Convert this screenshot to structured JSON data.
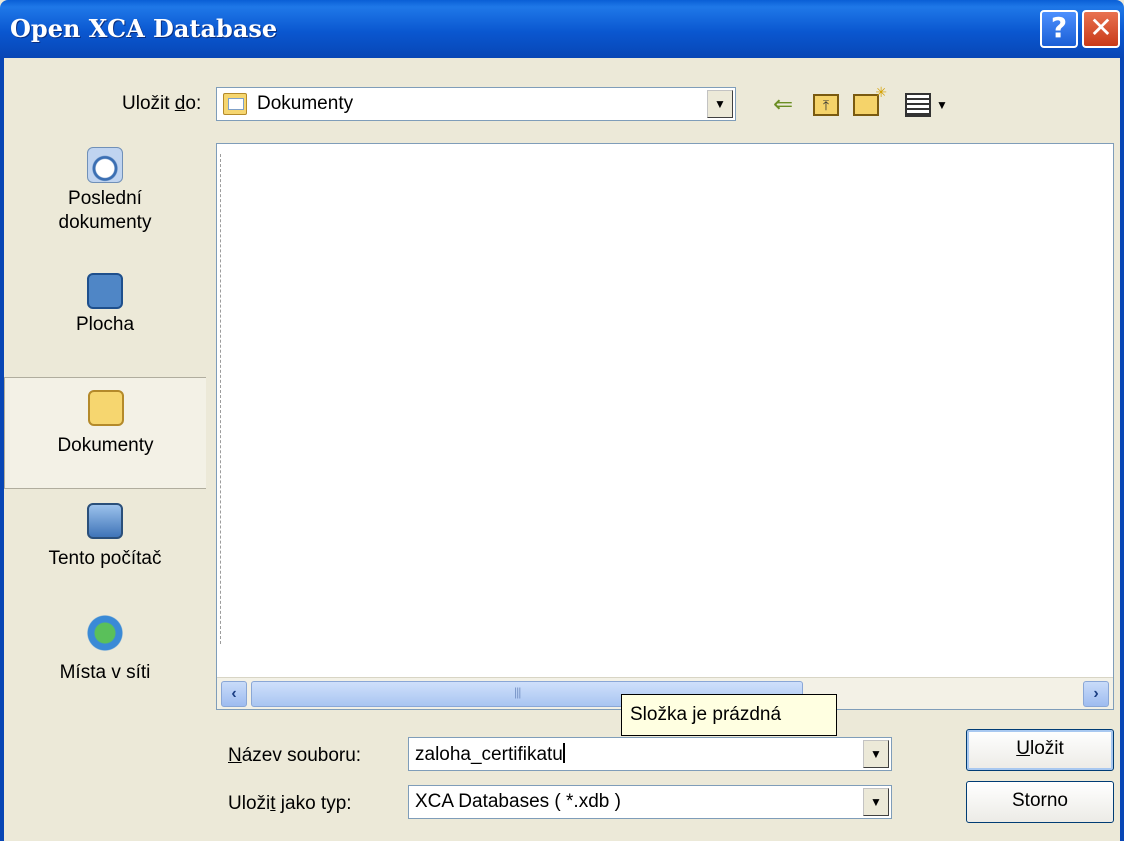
{
  "window": {
    "title": "Open XCA Database",
    "help_glyph": "?",
    "close_glyph": "✕"
  },
  "toolbar": {
    "lookin_label_pre": "Uložit ",
    "lookin_label_accel": "d",
    "lookin_label_post": "o:",
    "lookin_value": "Dokumenty",
    "icons": [
      "back-icon",
      "up-folder-icon",
      "new-folder-icon",
      "views-menu-icon"
    ]
  },
  "places": {
    "recent_line1": "Poslední",
    "recent_line2": "dokumenty",
    "desktop": "Plocha",
    "documents": "Dokumenty",
    "computer": "Tento počítač",
    "network": "Místa v síti"
  },
  "filelist": {
    "empty_tooltip": "Složka je prázdná"
  },
  "form": {
    "filename_label_accel": "N",
    "filename_label_rest": "ázev souboru:",
    "filename_value": "zaloha_certifikatu",
    "filetype_label_pre": "Uloži",
    "filetype_label_accel": "t",
    "filetype_label_post": " jako typ:",
    "filetype_value": "XCA Databases ( *.xdb )"
  },
  "buttons": {
    "save_accel": "U",
    "save_rest": "ložit",
    "cancel": "Storno"
  },
  "colors": {
    "titlebar": "#0a57d0",
    "dialog_bg": "#ece9d8",
    "tooltip_bg": "#ffffe1"
  }
}
